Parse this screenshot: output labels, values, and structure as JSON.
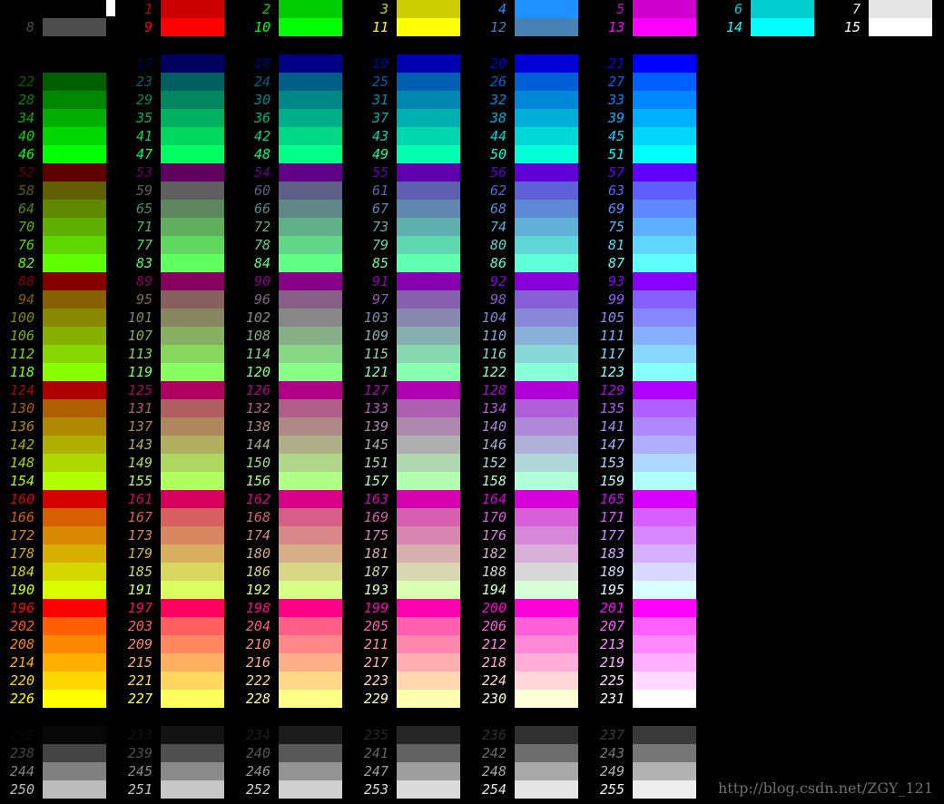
{
  "watermark_text": "http://blog.csdn.net/ZGY_121",
  "palette": [
    "#000000",
    "#cd0000",
    "#00cd00",
    "#cdcd00",
    "#1e90ff",
    "#cd00cd",
    "#00cdcd",
    "#e5e5e5",
    "#4d4d4d",
    "#ff0000",
    "#00ff00",
    "#ffff00",
    "#4682b4",
    "#ff00ff",
    "#00ffff",
    "#ffffff",
    "#000000",
    "#00005f",
    "#000087",
    "#0000af",
    "#0000d7",
    "#0000ff",
    "#005f00",
    "#005f5f",
    "#005f87",
    "#005faf",
    "#005fd7",
    "#005fff",
    "#008700",
    "#00875f",
    "#008787",
    "#0087af",
    "#0087d7",
    "#0087ff",
    "#00af00",
    "#00af5f",
    "#00af87",
    "#00afaf",
    "#00afd7",
    "#00afff",
    "#00d700",
    "#00d75f",
    "#00d787",
    "#00d7af",
    "#00d7d7",
    "#00d7ff",
    "#00ff00",
    "#00ff5f",
    "#00ff87",
    "#00ffaf",
    "#00ffd7",
    "#00ffff",
    "#5f0000",
    "#5f005f",
    "#5f0087",
    "#5f00af",
    "#5f00d7",
    "#5f00ff",
    "#5f5f00",
    "#5f5f5f",
    "#5f5f87",
    "#5f5faf",
    "#5f5fd7",
    "#5f5fff",
    "#5f8700",
    "#5f875f",
    "#5f8787",
    "#5f87af",
    "#5f87d7",
    "#5f87ff",
    "#5faf00",
    "#5faf5f",
    "#5faf87",
    "#5fafaf",
    "#5fafd7",
    "#5fafff",
    "#5fd700",
    "#5fd75f",
    "#5fd787",
    "#5fd7af",
    "#5fd7d7",
    "#5fd7ff",
    "#5fff00",
    "#5fff5f",
    "#5fff87",
    "#5fffaf",
    "#5fffd7",
    "#5fffff",
    "#870000",
    "#87005f",
    "#870087",
    "#8700af",
    "#8700d7",
    "#8700ff",
    "#875f00",
    "#875f5f",
    "#875f87",
    "#875faf",
    "#875fd7",
    "#875fff",
    "#878700",
    "#87875f",
    "#878787",
    "#8787af",
    "#8787d7",
    "#8787ff",
    "#87af00",
    "#87af5f",
    "#87af87",
    "#87afaf",
    "#87afd7",
    "#87afff",
    "#87d700",
    "#87d75f",
    "#87d787",
    "#87d7af",
    "#87d7d7",
    "#87d7ff",
    "#87ff00",
    "#87ff5f",
    "#87ff87",
    "#87ffaf",
    "#87ffd7",
    "#87ffff",
    "#af0000",
    "#af005f",
    "#af0087",
    "#af00af",
    "#af00d7",
    "#af00ff",
    "#af5f00",
    "#af5f5f",
    "#af5f87",
    "#af5faf",
    "#af5fd7",
    "#af5fff",
    "#af8700",
    "#af875f",
    "#af8787",
    "#af87af",
    "#af87d7",
    "#af87ff",
    "#afaf00",
    "#afaf5f",
    "#afaf87",
    "#afafaf",
    "#afafd7",
    "#afafff",
    "#afd700",
    "#afd75f",
    "#afd787",
    "#afd7af",
    "#afd7d7",
    "#afd7ff",
    "#afff00",
    "#afff5f",
    "#afff87",
    "#afffaf",
    "#afffd7",
    "#afffff",
    "#d70000",
    "#d7005f",
    "#d70087",
    "#d700af",
    "#d700d7",
    "#d700ff",
    "#d75f00",
    "#d75f5f",
    "#d75f87",
    "#d75faf",
    "#d75fd7",
    "#d75fff",
    "#d78700",
    "#d7875f",
    "#d78787",
    "#d787af",
    "#d787d7",
    "#d787ff",
    "#d7af00",
    "#d7af5f",
    "#d7af87",
    "#d7afaf",
    "#d7afd7",
    "#d7afff",
    "#d7d700",
    "#d7d75f",
    "#d7d787",
    "#d7d7af",
    "#d7d7d7",
    "#d7d7ff",
    "#d7ff00",
    "#d7ff5f",
    "#d7ff87",
    "#d7ffaf",
    "#d7ffd7",
    "#d7ffff",
    "#ff0000",
    "#ff005f",
    "#ff0087",
    "#ff00af",
    "#ff00d7",
    "#ff00ff",
    "#ff5f00",
    "#ff5f5f",
    "#ff5f87",
    "#ff5faf",
    "#ff5fd7",
    "#ff5fff",
    "#ff8700",
    "#ff875f",
    "#ff8787",
    "#ff87af",
    "#ff87d7",
    "#ff87ff",
    "#ffaf00",
    "#ffaf5f",
    "#ffaf87",
    "#ffafaf",
    "#ffafd7",
    "#ffafff",
    "#ffd700",
    "#ffd75f",
    "#ffd787",
    "#ffd7af",
    "#ffd7d7",
    "#ffd7ff",
    "#ffff00",
    "#ffff5f",
    "#ffff87",
    "#ffffaf",
    "#ffffd7",
    "#ffffff",
    "#080808",
    "#121212",
    "#1c1c1c",
    "#262626",
    "#303030",
    "#3a3a3a",
    "#444444",
    "#4e4e4e",
    "#585858",
    "#626262",
    "#6c6c6c",
    "#767676",
    "#808080",
    "#8a8a8a",
    "#949494",
    "#9e9e9e",
    "#a8a8a8",
    "#b2b2b2",
    "#bcbcbc",
    "#c6c6c6",
    "#d0d0d0",
    "#dadada",
    "#e4e4e4",
    "#eeeeee"
  ]
}
